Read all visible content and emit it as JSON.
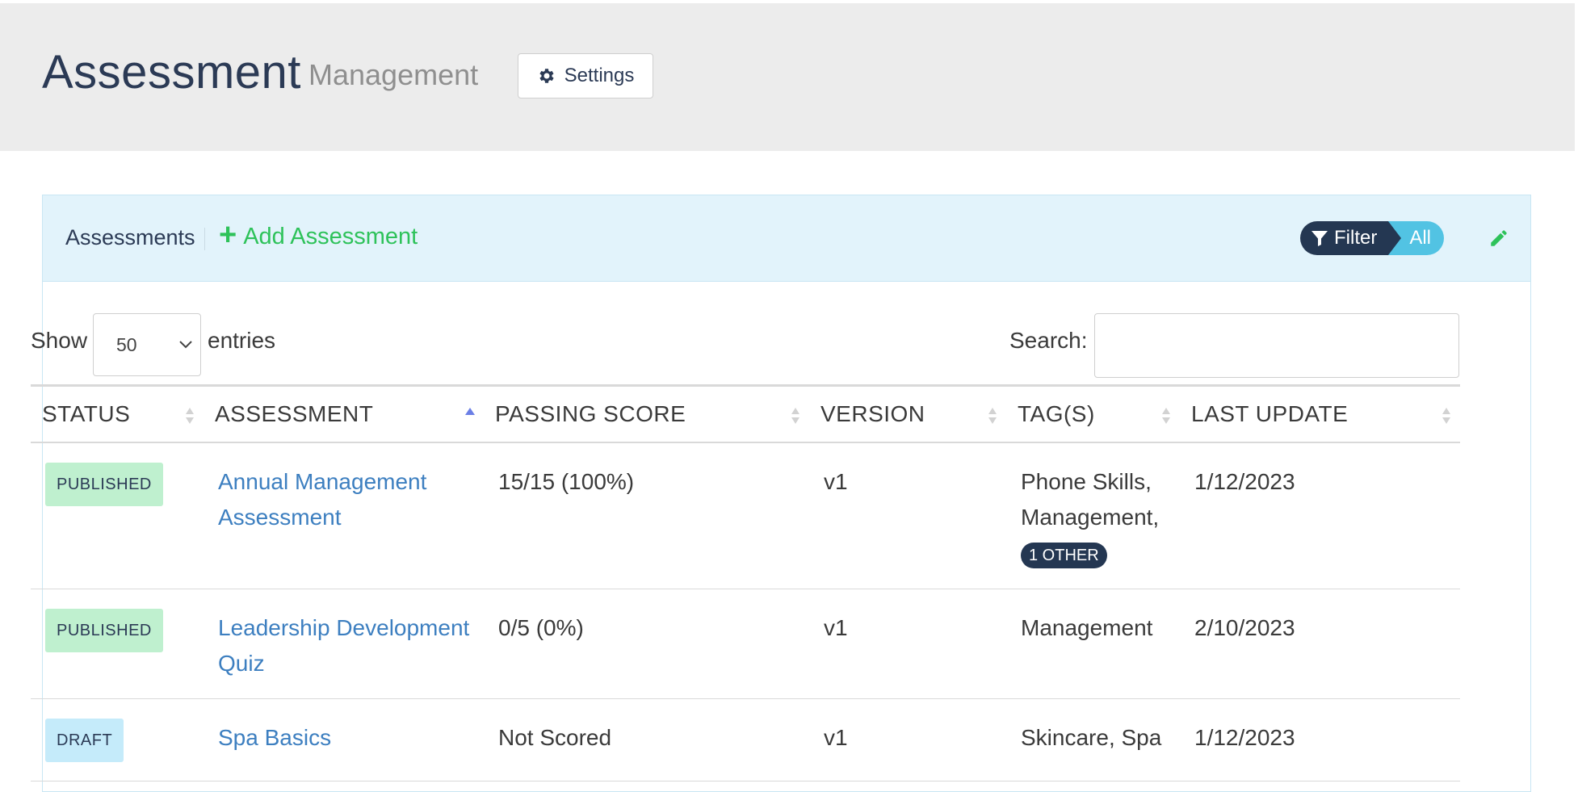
{
  "header": {
    "title": "Assessment",
    "subtitle": "Management",
    "settings_label": "Settings"
  },
  "panel": {
    "title": "Assessments",
    "add_label": "Add Assessment",
    "filter_label": "Filter",
    "filter_value": "All"
  },
  "controls": {
    "show_label": "Show",
    "page_length": "50",
    "entries_label": "entries",
    "search_label": "Search:",
    "search_value": ""
  },
  "table": {
    "columns": [
      "STATUS",
      "ASSESSMENT",
      "PASSING SCORE",
      "VERSION",
      "TAG(S)",
      "LAST UPDATE"
    ],
    "rows": [
      {
        "status": "PUBLISHED",
        "assessment": "Annual Management Assessment",
        "passing_score": "15/15 (100%)",
        "version": "v1",
        "tags": "Phone Skills, Management,",
        "tags_more": "1 OTHER",
        "last_update": "1/12/2023"
      },
      {
        "status": "PUBLISHED",
        "assessment": "Leadership Development Quiz",
        "passing_score": "0/5 (0%)",
        "version": "v1",
        "tags": "Management",
        "last_update": "2/10/2023"
      },
      {
        "status": "DRAFT",
        "assessment": "Spa Basics",
        "passing_score": "Not Scored",
        "version": "v1",
        "tags": "Skincare, Spa",
        "last_update": "1/12/2023"
      }
    ]
  },
  "colors": {
    "header_bg": "#ececec",
    "panel_head_bg": "#e2f3fb",
    "navy": "#243752",
    "green": "#2ec25a",
    "link": "#3d7fc0",
    "published_bg": "#bff0cf",
    "draft_bg": "#c5ebfa",
    "filter_all_bg": "#52c3e3"
  },
  "icons": {
    "settings": "gear-icon",
    "add": "plus-icon",
    "filter": "funnel-icon",
    "edit": "pencil-icon",
    "select": "chevron-down-icon",
    "sort": "sort-arrows-icon"
  }
}
